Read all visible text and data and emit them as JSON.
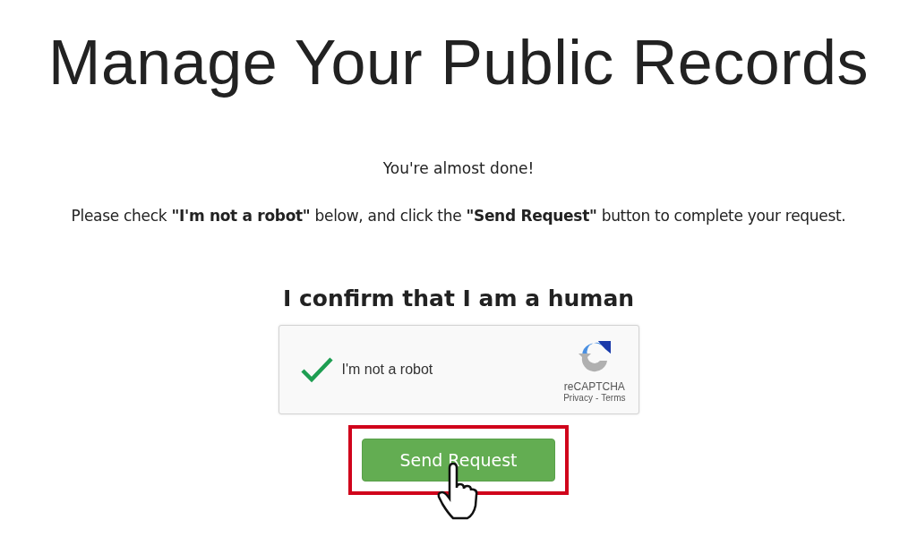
{
  "title": "Manage Your Public Records",
  "intro": "You're almost done!",
  "instruction": "Please check **\"I'm not a robot\"** below, and click the **\"Send Request\"** button to complete your request.",
  "confirm_heading": "I confirm that I am a human",
  "captcha": {
    "label": "I'm not a robot",
    "checked": true,
    "brand": "reCAPTCHA",
    "privacy": "Privacy",
    "separator": "-",
    "terms": "Terms"
  },
  "button": {
    "label": "Send Request",
    "highlighted": true
  }
}
